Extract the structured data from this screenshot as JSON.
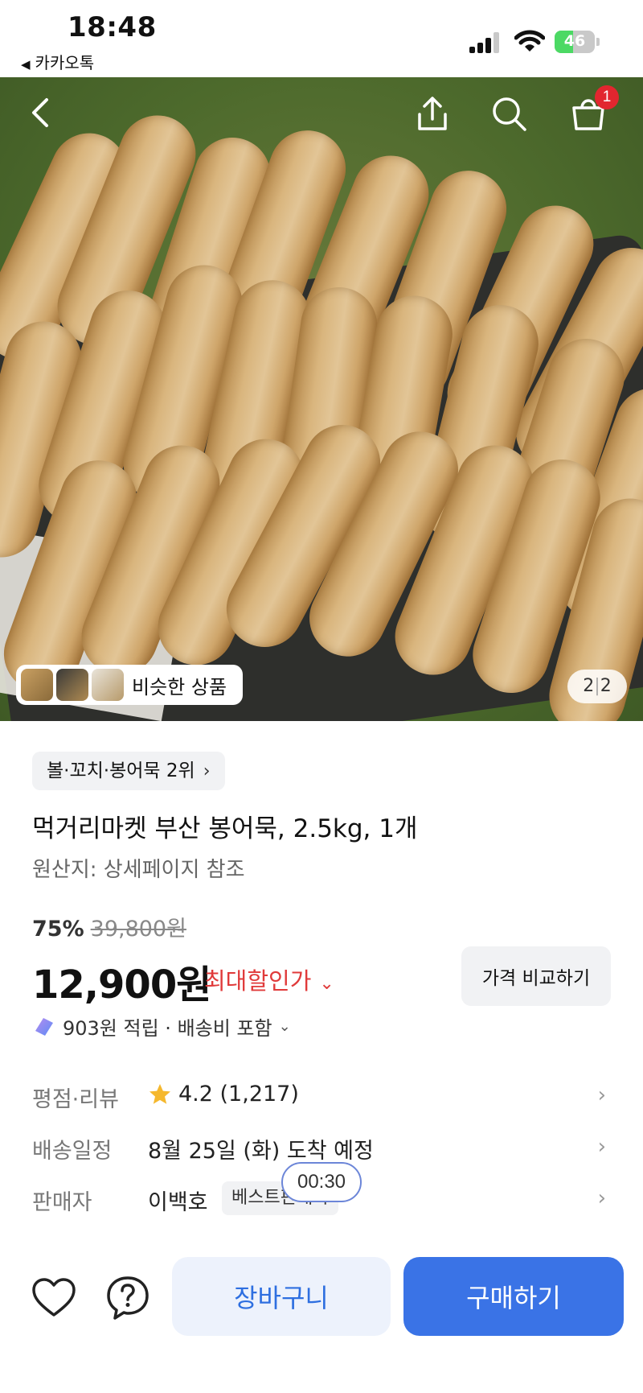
{
  "status_bar": {
    "time": "18:48",
    "back_app_label": "카카오톡",
    "battery": "46",
    "battery_level": 0.46
  },
  "hero": {
    "cart_badge": "1",
    "similar_label": "비슷한 상품",
    "page_current": "2",
    "page_separator": "|",
    "page_total": "2",
    "icons": [
      "back-arrow-icon",
      "share-icon",
      "search-icon",
      "cart-icon"
    ]
  },
  "product": {
    "rank_label": "볼·꼬치·봉어묵 2위",
    "title": "먹거리마켓 부산 봉어묵, 2.5kg, 1개",
    "origin": "원산지: 상세페이지 참조",
    "discount_percent": "75%",
    "original_price": "39,800원",
    "price": "12,900원",
    "max_discount_label": "최대할인가",
    "compare_label": "가격 비교하기",
    "points_label": "903원 적립 · 배송비 포함"
  },
  "info": {
    "rating_label": "평점·리뷰",
    "rating_value": "4.2 (1,217)",
    "rating": 4.2,
    "delivery_label": "배송일정",
    "delivery_value": "8월 25일 (화) 도착 예정",
    "seller_label": "판매자",
    "seller_value": "이백호",
    "seller_badge": "베스트판매자",
    "timer": "00:30"
  },
  "bottom_bar": {
    "cart_label": "장바구니",
    "buy_label": "구매하기"
  },
  "colors": {
    "accent_blue": "#3a73e6",
    "cart_bg": "#edf2fc",
    "discount_red": "#e03a3a",
    "badge_red": "#e2262f"
  }
}
